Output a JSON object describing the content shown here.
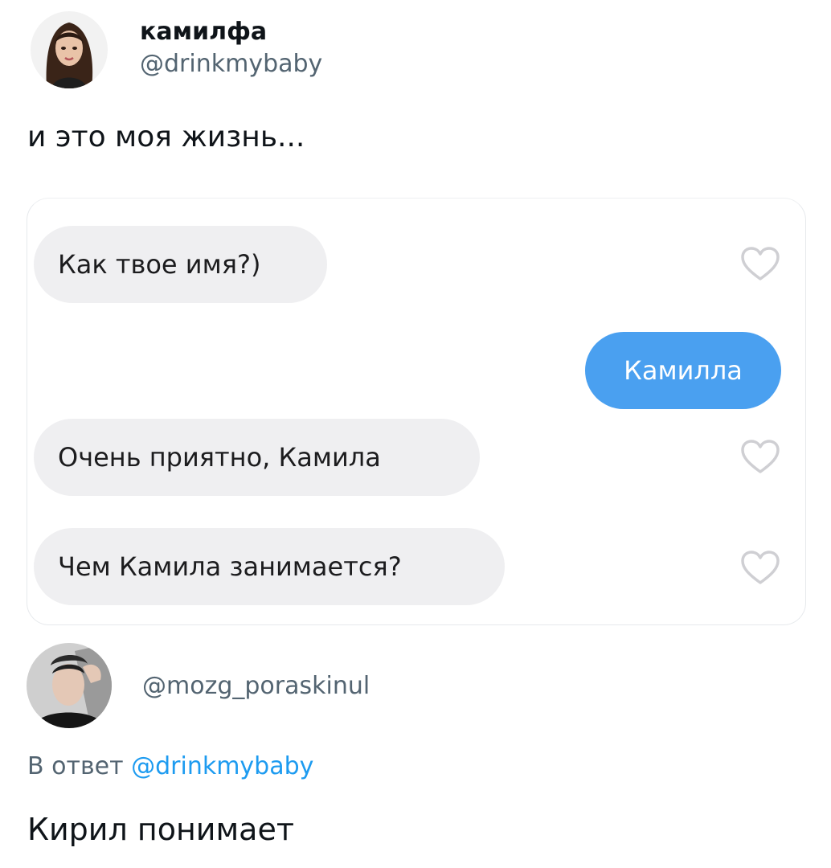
{
  "tweet": {
    "display_name": "камилфа",
    "handle": "@drinkmybaby",
    "text": "и это моя жизнь..."
  },
  "chat": {
    "messages": [
      {
        "text": "Как твое имя?)",
        "direction": "incoming",
        "liked": false
      },
      {
        "text": "Камилла",
        "direction": "outgoing"
      },
      {
        "text": "Очень приятно, Камила",
        "direction": "incoming",
        "liked": false
      },
      {
        "text": "Чем Камила занимается?",
        "direction": "incoming",
        "liked": false
      }
    ],
    "colors": {
      "incoming_bubble": "#efeff1",
      "outgoing_bubble": "#4aa0f0"
    }
  },
  "reply": {
    "handle": "@mozg_poraskinul",
    "reply_to_prefix": "В ответ",
    "reply_to_handle": "@drinkmybaby",
    "text": "Кирил понимает"
  },
  "icons": [
    "avatar",
    "heart-icon"
  ],
  "colors": {
    "link": "#1d9bf0",
    "secondary_text": "#536471",
    "primary_text": "#0f1419"
  }
}
